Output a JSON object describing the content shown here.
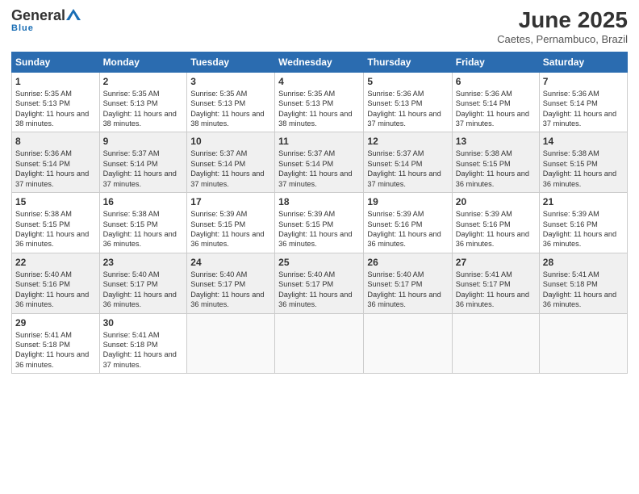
{
  "header": {
    "logo_general": "General",
    "logo_blue": "Blue",
    "month_year": "June 2025",
    "location": "Caetes, Pernambuco, Brazil"
  },
  "days_of_week": [
    "Sunday",
    "Monday",
    "Tuesday",
    "Wednesday",
    "Thursday",
    "Friday",
    "Saturday"
  ],
  "weeks": [
    [
      {
        "day": "1",
        "sunrise": "Sunrise: 5:35 AM",
        "sunset": "Sunset: 5:13 PM",
        "daylight": "Daylight: 11 hours and 38 minutes."
      },
      {
        "day": "2",
        "sunrise": "Sunrise: 5:35 AM",
        "sunset": "Sunset: 5:13 PM",
        "daylight": "Daylight: 11 hours and 38 minutes."
      },
      {
        "day": "3",
        "sunrise": "Sunrise: 5:35 AM",
        "sunset": "Sunset: 5:13 PM",
        "daylight": "Daylight: 11 hours and 38 minutes."
      },
      {
        "day": "4",
        "sunrise": "Sunrise: 5:35 AM",
        "sunset": "Sunset: 5:13 PM",
        "daylight": "Daylight: 11 hours and 38 minutes."
      },
      {
        "day": "5",
        "sunrise": "Sunrise: 5:36 AM",
        "sunset": "Sunset: 5:13 PM",
        "daylight": "Daylight: 11 hours and 37 minutes."
      },
      {
        "day": "6",
        "sunrise": "Sunrise: 5:36 AM",
        "sunset": "Sunset: 5:14 PM",
        "daylight": "Daylight: 11 hours and 37 minutes."
      },
      {
        "day": "7",
        "sunrise": "Sunrise: 5:36 AM",
        "sunset": "Sunset: 5:14 PM",
        "daylight": "Daylight: 11 hours and 37 minutes."
      }
    ],
    [
      {
        "day": "8",
        "sunrise": "Sunrise: 5:36 AM",
        "sunset": "Sunset: 5:14 PM",
        "daylight": "Daylight: 11 hours and 37 minutes."
      },
      {
        "day": "9",
        "sunrise": "Sunrise: 5:37 AM",
        "sunset": "Sunset: 5:14 PM",
        "daylight": "Daylight: 11 hours and 37 minutes."
      },
      {
        "day": "10",
        "sunrise": "Sunrise: 5:37 AM",
        "sunset": "Sunset: 5:14 PM",
        "daylight": "Daylight: 11 hours and 37 minutes."
      },
      {
        "day": "11",
        "sunrise": "Sunrise: 5:37 AM",
        "sunset": "Sunset: 5:14 PM",
        "daylight": "Daylight: 11 hours and 37 minutes."
      },
      {
        "day": "12",
        "sunrise": "Sunrise: 5:37 AM",
        "sunset": "Sunset: 5:14 PM",
        "daylight": "Daylight: 11 hours and 37 minutes."
      },
      {
        "day": "13",
        "sunrise": "Sunrise: 5:38 AM",
        "sunset": "Sunset: 5:15 PM",
        "daylight": "Daylight: 11 hours and 36 minutes."
      },
      {
        "day": "14",
        "sunrise": "Sunrise: 5:38 AM",
        "sunset": "Sunset: 5:15 PM",
        "daylight": "Daylight: 11 hours and 36 minutes."
      }
    ],
    [
      {
        "day": "15",
        "sunrise": "Sunrise: 5:38 AM",
        "sunset": "Sunset: 5:15 PM",
        "daylight": "Daylight: 11 hours and 36 minutes."
      },
      {
        "day": "16",
        "sunrise": "Sunrise: 5:38 AM",
        "sunset": "Sunset: 5:15 PM",
        "daylight": "Daylight: 11 hours and 36 minutes."
      },
      {
        "day": "17",
        "sunrise": "Sunrise: 5:39 AM",
        "sunset": "Sunset: 5:15 PM",
        "daylight": "Daylight: 11 hours and 36 minutes."
      },
      {
        "day": "18",
        "sunrise": "Sunrise: 5:39 AM",
        "sunset": "Sunset: 5:15 PM",
        "daylight": "Daylight: 11 hours and 36 minutes."
      },
      {
        "day": "19",
        "sunrise": "Sunrise: 5:39 AM",
        "sunset": "Sunset: 5:16 PM",
        "daylight": "Daylight: 11 hours and 36 minutes."
      },
      {
        "day": "20",
        "sunrise": "Sunrise: 5:39 AM",
        "sunset": "Sunset: 5:16 PM",
        "daylight": "Daylight: 11 hours and 36 minutes."
      },
      {
        "day": "21",
        "sunrise": "Sunrise: 5:39 AM",
        "sunset": "Sunset: 5:16 PM",
        "daylight": "Daylight: 11 hours and 36 minutes."
      }
    ],
    [
      {
        "day": "22",
        "sunrise": "Sunrise: 5:40 AM",
        "sunset": "Sunset: 5:16 PM",
        "daylight": "Daylight: 11 hours and 36 minutes."
      },
      {
        "day": "23",
        "sunrise": "Sunrise: 5:40 AM",
        "sunset": "Sunset: 5:17 PM",
        "daylight": "Daylight: 11 hours and 36 minutes."
      },
      {
        "day": "24",
        "sunrise": "Sunrise: 5:40 AM",
        "sunset": "Sunset: 5:17 PM",
        "daylight": "Daylight: 11 hours and 36 minutes."
      },
      {
        "day": "25",
        "sunrise": "Sunrise: 5:40 AM",
        "sunset": "Sunset: 5:17 PM",
        "daylight": "Daylight: 11 hours and 36 minutes."
      },
      {
        "day": "26",
        "sunrise": "Sunrise: 5:40 AM",
        "sunset": "Sunset: 5:17 PM",
        "daylight": "Daylight: 11 hours and 36 minutes."
      },
      {
        "day": "27",
        "sunrise": "Sunrise: 5:41 AM",
        "sunset": "Sunset: 5:17 PM",
        "daylight": "Daylight: 11 hours and 36 minutes."
      },
      {
        "day": "28",
        "sunrise": "Sunrise: 5:41 AM",
        "sunset": "Sunset: 5:18 PM",
        "daylight": "Daylight: 11 hours and 36 minutes."
      }
    ],
    [
      {
        "day": "29",
        "sunrise": "Sunrise: 5:41 AM",
        "sunset": "Sunset: 5:18 PM",
        "daylight": "Daylight: 11 hours and 36 minutes."
      },
      {
        "day": "30",
        "sunrise": "Sunrise: 5:41 AM",
        "sunset": "Sunset: 5:18 PM",
        "daylight": "Daylight: 11 hours and 37 minutes."
      },
      {
        "day": "",
        "sunrise": "",
        "sunset": "",
        "daylight": ""
      },
      {
        "day": "",
        "sunrise": "",
        "sunset": "",
        "daylight": ""
      },
      {
        "day": "",
        "sunrise": "",
        "sunset": "",
        "daylight": ""
      },
      {
        "day": "",
        "sunrise": "",
        "sunset": "",
        "daylight": ""
      },
      {
        "day": "",
        "sunrise": "",
        "sunset": "",
        "daylight": ""
      }
    ]
  ]
}
